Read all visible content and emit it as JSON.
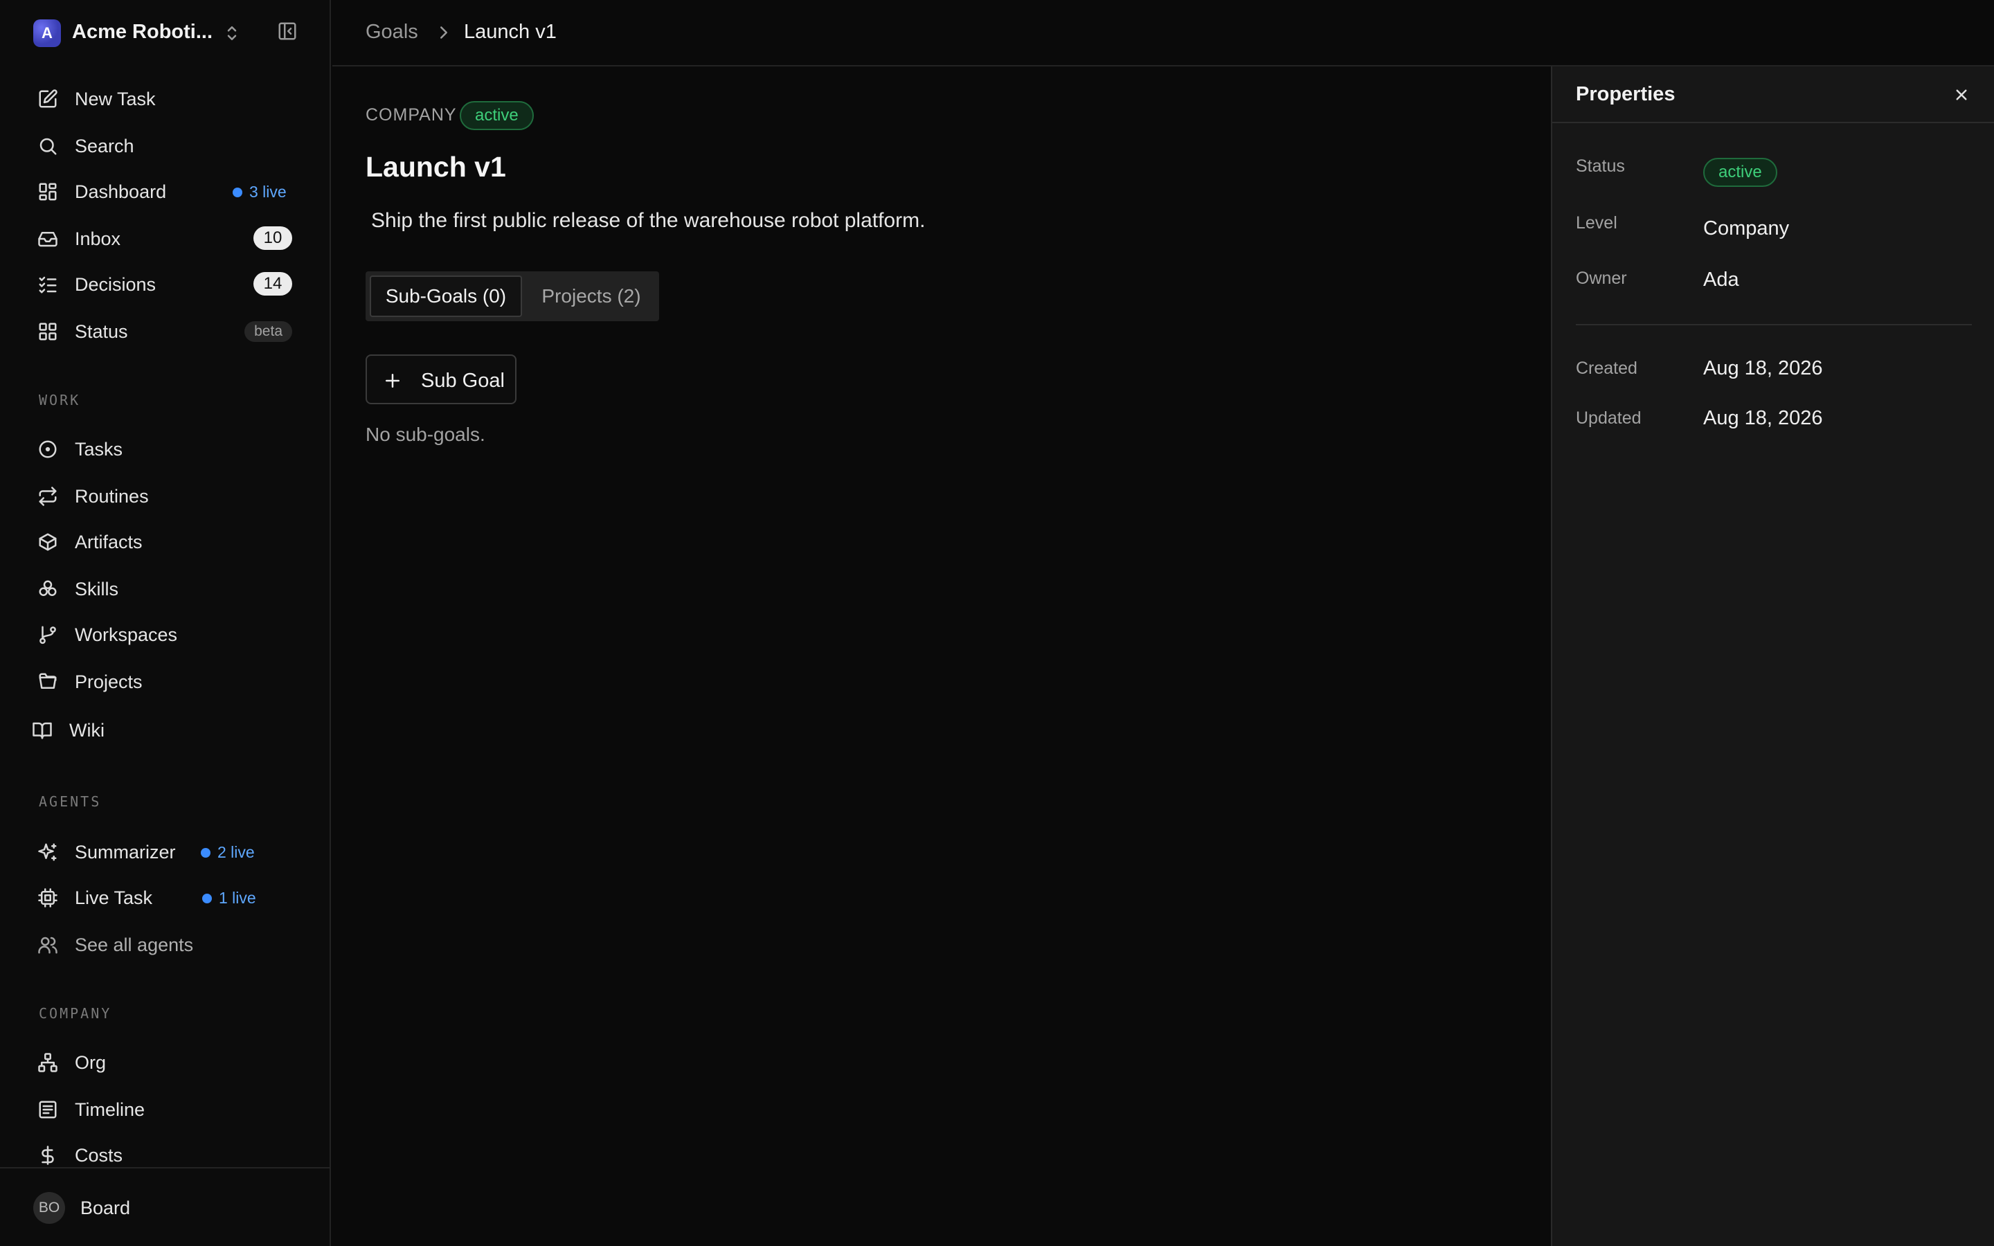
{
  "sidebar": {
    "company_initial": "A",
    "company_name": "Acme Roboti...",
    "primary": [
      {
        "label": "New Task"
      },
      {
        "label": "Search"
      },
      {
        "label": "Dashboard",
        "live": "3 live"
      },
      {
        "label": "Inbox",
        "count": "10"
      },
      {
        "label": "Decisions",
        "count": "14"
      },
      {
        "label": "Status",
        "badge": "beta"
      }
    ],
    "work_label": "WORK",
    "work": [
      {
        "label": "Tasks"
      },
      {
        "label": "Routines"
      },
      {
        "label": "Artifacts"
      },
      {
        "label": "Skills"
      },
      {
        "label": "Workspaces"
      },
      {
        "label": "Projects"
      },
      {
        "label": "Wiki"
      }
    ],
    "agents_label": "AGENTS",
    "agents": [
      {
        "label": "Summarizer",
        "live": "2 live"
      },
      {
        "label": "Live Task",
        "live": "1 live"
      },
      {
        "label": "See all agents"
      }
    ],
    "company_label": "COMPANY",
    "company": [
      {
        "label": "Org"
      },
      {
        "label": "Timeline"
      },
      {
        "label": "Costs"
      }
    ],
    "footer": {
      "avatar_initials": "BO",
      "name": "Board"
    }
  },
  "breadcrumb": {
    "parent": "Goals",
    "current": "Launch v1"
  },
  "goal": {
    "level": "COMPANY",
    "status": "active",
    "title": "Launch v1",
    "description": "Ship the first public release of the warehouse robot platform.",
    "tabs": [
      {
        "label": "Sub-Goals (0)",
        "active": true
      },
      {
        "label": "Projects (2)",
        "active": false
      }
    ],
    "add_button": "Sub Goal",
    "empty": "No sub-goals."
  },
  "properties": {
    "title": "Properties",
    "status_label": "Status",
    "status_value": "active",
    "level_label": "Level",
    "level_value": "Company",
    "owner_label": "Owner",
    "owner_value": "Ada",
    "created_label": "Created",
    "created_value": "Aug 18, 2026",
    "updated_label": "Updated",
    "updated_value": "Aug 18, 2026"
  },
  "colors": {
    "background": "#0a0a0a",
    "sidebar": "#0c0c0c",
    "panel": "#171717",
    "active_green": "#3ecf7a",
    "live_blue": "#3b8cff",
    "logo": "#3b3fb6"
  }
}
